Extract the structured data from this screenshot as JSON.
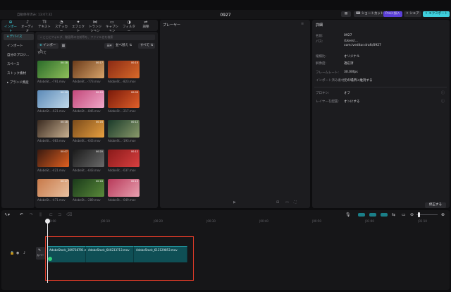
{
  "titlebar": {
    "autosave": "自動保存済み: 13:07:32",
    "project_title": "0927",
    "shortcut_label": "ショートカット",
    "pro_label": "Proに加入",
    "share_label": "シェア",
    "export_label": "エクスポート"
  },
  "tabs": [
    {
      "icon": "import-icon",
      "glyph": "⊕",
      "label": "インポート"
    },
    {
      "icon": "audio-icon",
      "glyph": "♪",
      "label": "オーディオ"
    },
    {
      "icon": "text-icon",
      "glyph": "TI",
      "label": "テキスト"
    },
    {
      "icon": "sticker-icon",
      "glyph": "◔",
      "label": "ステッカー"
    },
    {
      "icon": "effect-icon",
      "glyph": "✦",
      "label": "エフェクト"
    },
    {
      "icon": "transition-icon",
      "glyph": "⋈",
      "label": "トランジション"
    },
    {
      "icon": "caption-icon",
      "glyph": "▭",
      "label": "キャプション"
    },
    {
      "icon": "filter-icon",
      "glyph": "◑",
      "label": "フィルター"
    },
    {
      "icon": "adjust-icon",
      "glyph": "⇌",
      "label": "調整"
    }
  ],
  "sidebar": {
    "items": [
      {
        "label": "▾ デバイス"
      },
      {
        "label": "インポート"
      },
      {
        "label": "自分のプロジ..."
      },
      {
        "label": "スペース"
      },
      {
        "label": "ストック素材"
      },
      {
        "label": "▸ ブランド資産"
      }
    ]
  },
  "media": {
    "search_placeholder": "ここにフォルダ、動画等の名前等を、ファイル名を検索",
    "import_label": "インポート",
    "sort_label": "並べ替え",
    "all_filter": "すべて",
    "section_label": "すべて",
    "thumbs": [
      {
        "caption": "AdobeSt...-791.mov",
        "duration": "00:18",
        "c1": "#2b6b2a",
        "c2": "#8fbf5a"
      },
      {
        "caption": "AdobeSt...-773.mov",
        "duration": "00:17",
        "c1": "#6b3b1a",
        "c2": "#d8a46a"
      },
      {
        "caption": "AdobeSt...-823.mov",
        "duration": "00:15",
        "c1": "#8a2a14",
        "c2": "#d96a2a"
      },
      {
        "caption": "AdobeSt...-621.mov",
        "duration": "00:10",
        "c1": "#5c8ab8",
        "c2": "#c0d8e8"
      },
      {
        "caption": "AdobeSt...-846.mov",
        "duration": "00:10",
        "c1": "#c2487a",
        "c2": "#f0a8c8"
      },
      {
        "caption": "AdobeSt...-217.mov",
        "duration": "00:09",
        "c1": "#7a1a0a",
        "c2": "#e0602a"
      },
      {
        "caption": "AdobeSt...-083.mov",
        "duration": "00:18",
        "c1": "#3a2a20",
        "c2": "#c8b090"
      },
      {
        "caption": "AdobeSt...-643.mov",
        "duration": "00:16",
        "c1": "#7a4a1a",
        "c2": "#e8a040"
      },
      {
        "caption": "AdobeSt...-193.mov",
        "duration": "00:12",
        "c1": "#1a3a2a",
        "c2": "#8a9a6a"
      },
      {
        "caption": "AdobeSt...-421.mov",
        "duration": "00:07",
        "c1": "#3a1a10",
        "c2": "#e06020"
      },
      {
        "caption": "AdobeSt...-643.mov",
        "duration": "00:20",
        "c1": "#1a1a1a",
        "c2": "#6a6a6a"
      },
      {
        "caption": "AdobeSt...-037.mov",
        "duration": "00:12",
        "c1": "#8a1a1a",
        "c2": "#d84040"
      },
      {
        "caption": "AdobeSt...-471.mov",
        "duration": "00:17",
        "c1": "#c87a4a",
        "c2": "#e8c0a0"
      },
      {
        "caption": "AdobeSt...-289.mov",
        "duration": "00:18",
        "c1": "#1a3a1a",
        "c2": "#5a8a3a"
      },
      {
        "caption": "AdobeSt...-049.mov",
        "duration": "00:13",
        "c1": "#b83a5a",
        "c2": "#e8a0b0"
      }
    ]
  },
  "player": {
    "title": "プレーヤー"
  },
  "details": {
    "title": "詳細",
    "rows": [
      {
        "label": "名前:",
        "value": "0927"
      },
      {
        "label": "パス:",
        "value": "/Users/..."
      },
      {
        "label": "",
        "value": "com.lveditor.draft/0927"
      },
      {
        "label": "縦横比:",
        "value": "オリジナル"
      },
      {
        "label": "解像度:",
        "value": "適応済"
      },
      {
        "label": "フレームレート:",
        "value": "30.00fps"
      },
      {
        "label": "インポート済み素材:",
        "value": "元の場所に維持する"
      },
      {
        "label": "プロキシ:",
        "value": "オフ"
      },
      {
        "label": "レイヤーを配置:",
        "value": "オンにする"
      }
    ],
    "modify_label": "修正する"
  },
  "timeline": {
    "ticks": [
      "00:00",
      "|00:10",
      "|00:20",
      "|00:30",
      "|00:40",
      "|00:50",
      "|01:00",
      "|01:10"
    ],
    "cover_label": "カバー",
    "clips": [
      {
        "label": "AdobeStock_389738791.mov"
      },
      {
        "label": "AdobeStock_640233713.mov"
      },
      {
        "label": "AdobeStock_612129853.mov"
      }
    ]
  },
  "colors": {
    "accent": "#3fd0dd",
    "selection": "#e23b28",
    "clip": "#0f4f55"
  }
}
